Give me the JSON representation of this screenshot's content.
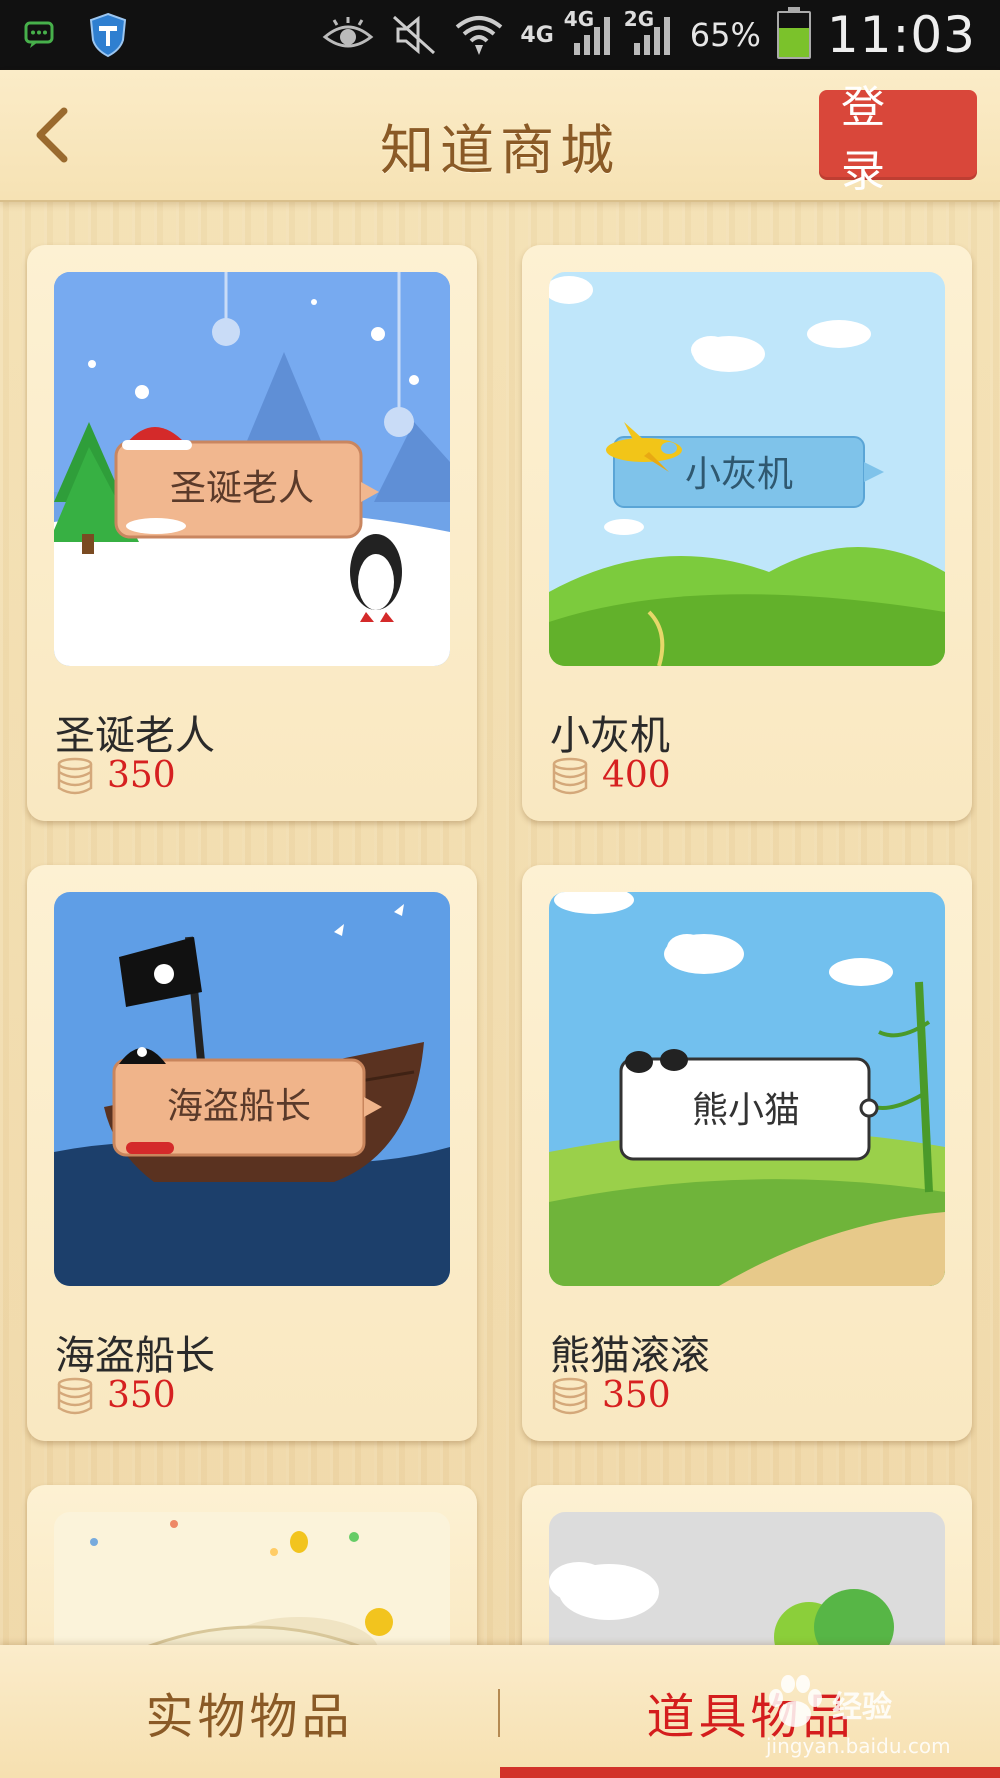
{
  "statusbar": {
    "network_1": "4G",
    "network_2": "4G",
    "network_3": "2G",
    "battery_percent": "65%",
    "battery_level": 0.65,
    "time": "11:03"
  },
  "header": {
    "title": "知道商城",
    "login_label": "登 录"
  },
  "items": [
    {
      "name": "圣诞老人",
      "price": "350",
      "banner": "圣诞老人"
    },
    {
      "name": "小灰机",
      "price": "400",
      "banner": "小灰机"
    },
    {
      "name": "海盗船长",
      "price": "350",
      "banner": "海盗船长"
    },
    {
      "name": "熊猫滚滚",
      "price": "350",
      "banner": "熊小猫"
    }
  ],
  "tabs": {
    "physical": "实物物品",
    "props": "道具物品",
    "active": "props"
  },
  "watermark": {
    "brand": "经验",
    "url": "jingyan.baidu.com"
  },
  "colors": {
    "accent_red": "#d9473a",
    "price_red": "#d62020",
    "title_brown": "#8a5a26"
  }
}
